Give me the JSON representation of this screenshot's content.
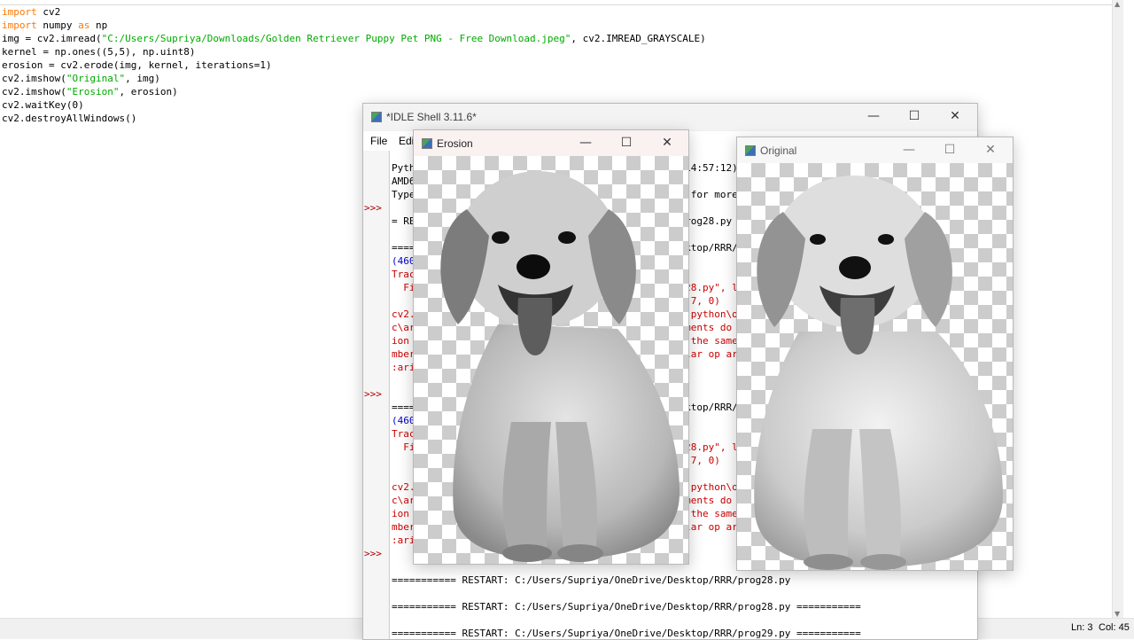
{
  "editor": {
    "code_lines": [
      [
        {
          "t": "import",
          "c": "kw"
        },
        {
          "t": " cv2",
          "c": ""
        }
      ],
      [
        {
          "t": "import",
          "c": "kw"
        },
        {
          "t": " numpy ",
          "c": ""
        },
        {
          "t": "as",
          "c": "kw"
        },
        {
          "t": " np",
          "c": ""
        }
      ],
      [
        {
          "t": "img = cv2.imread(",
          "c": ""
        },
        {
          "t": "\"C:/Users/Supriya/Downloads/Golden Retriever Puppy Pet PNG - Free Download.jpeg\"",
          "c": "str"
        },
        {
          "t": ", cv2.IMREAD_GRAYSCALE)",
          "c": ""
        }
      ],
      [
        {
          "t": "kernel = np.ones((5,5), np.uint8)",
          "c": ""
        }
      ],
      [
        {
          "t": "erosion = cv2.erode(img, kernel, iterations=1)",
          "c": ""
        }
      ],
      [
        {
          "t": "cv2.imshow(",
          "c": ""
        },
        {
          "t": "\"Original\"",
          "c": "str"
        },
        {
          "t": ", img)",
          "c": ""
        }
      ],
      [
        {
          "t": "cv2.imshow(",
          "c": ""
        },
        {
          "t": "\"Erosion\"",
          "c": "str"
        },
        {
          "t": ", erosion)",
          "c": ""
        }
      ],
      [
        {
          "t": "cv2.waitKey(0)",
          "c": ""
        }
      ],
      [
        {
          "t": "cv2.destroyAllWindows()",
          "c": ""
        }
      ]
    ],
    "status": {
      "line": "Ln: 3",
      "col": "Col: 45"
    }
  },
  "shell": {
    "title": "*IDLE Shell 3.11.6*",
    "menu": [
      "File",
      "Edit"
    ],
    "prompt": ">>>",
    "lines": [
      {
        "t": "Python 3.11.6 (tags/v3.11.6:8b6ee5b, Oct  2 2023, 14:57:12) [MSC v.1935 64 bit (",
        "c": "blk"
      },
      {
        "t": "AMD64)] on win32",
        "c": "blk"
      },
      {
        "t": "Type \"help\", \"copyright\", \"credits\" or \"license()\" for more information.",
        "c": "blk"
      },
      {
        "t": "",
        "c": "blk"
      },
      {
        "t": "= RESTART: C:/Users/Supriya/OneDrive/Desktop/RRR/prog28.py",
        "c": "blk"
      },
      {
        "t": "",
        "c": "blk"
      },
      {
        "t": "=========== RESTART: C:/Users/Supriya/OneDrive/Desktop/RRR/prog28.py",
        "c": "blk"
      },
      {
        "t": "(4608, 3456)",
        "c": "blue"
      },
      {
        "t": "Traceback (most recent call last):",
        "c": "red"
      },
      {
        "t": "  File \"C:/Users/Supriya/OneDrive/Desktop/RRR/prog28.py\", line 6, in <module>",
        "c": "red"
      },
      {
        "t": "    sharpened = cv2.addWeighted(img, 1.5, blur, -0.7, 0)",
        "c": "red"
      },
      {
        "t": "cv2.error: OpenCV(4.8.1) D:\\a\\opencv-python\\opencv-python\\opencv",
        "c": "red"
      },
      {
        "t": "c\\arithm.cpp:650: error: (-209:Sizes of input arguments do not match) The operat",
        "c": "red"
      },
      {
        "t": "ion is neither 'array op array' (where arrays have the same size and the same nu",
        "c": "red"
      },
      {
        "t": "mber of channels), nor 'array op scalar', nor 'scalar op array' in function 'cv:",
        "c": "red"
      },
      {
        "t": ":arithm_op'",
        "c": "red"
      },
      {
        "t": "",
        "c": "blk"
      },
      {
        "t": "",
        "c": "blk"
      },
      {
        "t": "=========== RESTART: C:/Users/Supriya/OneDrive/Desktop/RRR/prog28.py",
        "c": "blk"
      },
      {
        "t": "(4608, 3456)",
        "c": "blue"
      },
      {
        "t": "Traceback (most recent call last):",
        "c": "red"
      },
      {
        "t": "  File \"C:/Users/Supriya/OneDrive/Desktop/RRR/prog28.py\", line 6, in <module>",
        "c": "red"
      },
      {
        "t": "    sharpened = cv2.addWeighted(img, 1.5, blur, -0.7, 0)",
        "c": "red"
      },
      {
        "t": "",
        "c": "blk"
      },
      {
        "t": "cv2.error: OpenCV(4.8.1) D:\\a\\opencv-python\\opencv-python\\opencv",
        "c": "red"
      },
      {
        "t": "c\\arithm.cpp:650: error: (-209:Sizes of input arguments do not match) The operat",
        "c": "red"
      },
      {
        "t": "ion is neither 'array op array' (where arrays have the same size and the same nu",
        "c": "red"
      },
      {
        "t": "mber of channels), nor 'array op scalar', nor 'scalar op array' in function 'cv:",
        "c": "red"
      },
      {
        "t": ":arithm_op'",
        "c": "red"
      },
      {
        "t": "",
        "c": "blk"
      },
      {
        "t": "",
        "c": "blk"
      },
      {
        "t": "=========== RESTART: C:/Users/Supriya/OneDrive/Desktop/RRR/prog28.py",
        "c": "blk"
      },
      {
        "t": "",
        "c": "blk"
      },
      {
        "t": "=========== RESTART: C:/Users/Supriya/OneDrive/Desktop/RRR/prog28.py ===========",
        "c": "blk"
      },
      {
        "t": "",
        "c": "blk"
      },
      {
        "t": "=========== RESTART: C:/Users/Supriya/OneDrive/Desktop/RRR/prog29.py ===========",
        "c": "blk"
      }
    ],
    "prompt_rows": [
      3,
      17,
      29
    ]
  },
  "erosion_window": {
    "title": "Erosion"
  },
  "original_window": {
    "title": "Original"
  },
  "window_controls": {
    "minimize": "—",
    "maximize": "☐",
    "close": "✕"
  },
  "icons": {
    "app": "python-app-icon",
    "min": "minimize-icon",
    "max": "maximize-icon",
    "close": "close-icon"
  }
}
